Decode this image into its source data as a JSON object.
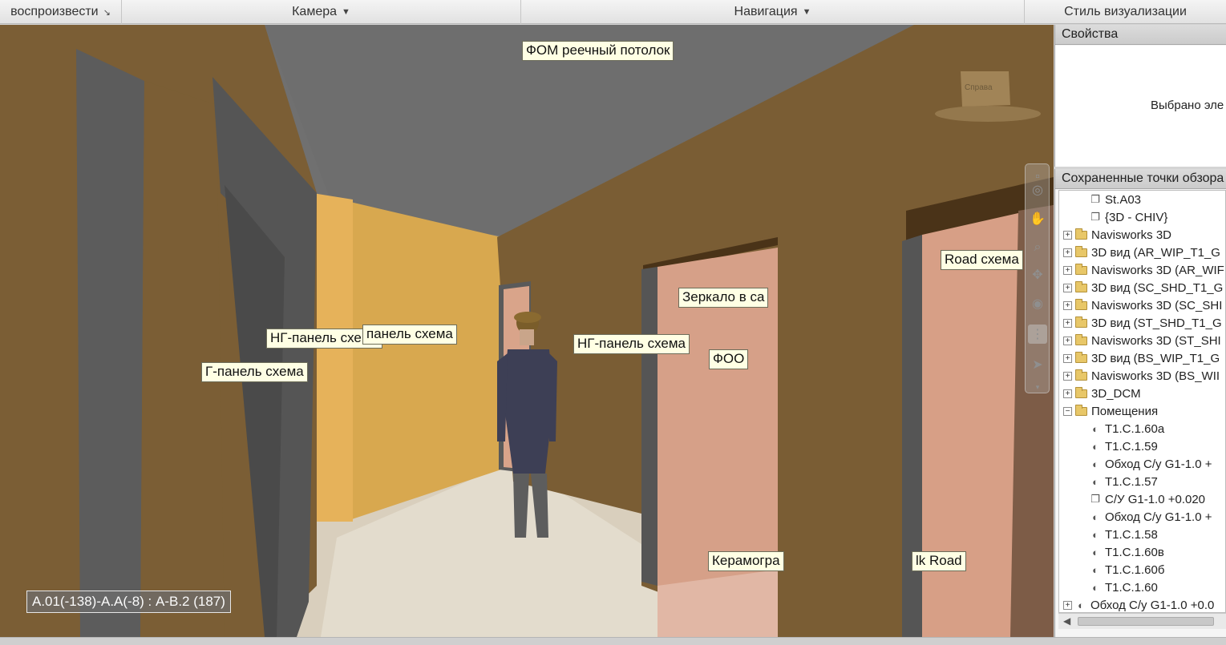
{
  "ribbon": {
    "groups": [
      {
        "label": "воспроизвести",
        "arrow": "↘"
      },
      {
        "label": "Камера",
        "arrow": "▼"
      },
      {
        "label": "Навигация",
        "arrow": "▼"
      },
      {
        "label": "Стиль визуализации",
        "arrow": ""
      }
    ]
  },
  "viewport": {
    "tags": [
      "ФОМ реечный потолок",
      "Road схема",
      "Зеркало в са",
      "НГ-панель схема",
      "ФОО",
      "НГ-панель схема",
      "панель схема",
      "Г-панель схема",
      "Керамогра",
      "lk Road"
    ],
    "coordinates": "А.01(-138)-А.А(-8) : А-В.2 (187)",
    "viewcube_label": "Справа",
    "colors": {
      "ceiling": "#707070",
      "wall_brown": "#7a5d35",
      "wall_yellow": "#d8a84e",
      "door_pink": "#d6a088",
      "floor": "#d7cdbb"
    }
  },
  "navbar": {
    "icons": [
      "wheel-icon",
      "pan-icon",
      "zoom-icon",
      "orbit-icon",
      "look-icon",
      "walk-icon",
      "select-icon"
    ]
  },
  "properties": {
    "title": "Свойства",
    "message": "Выбрано эле"
  },
  "viewpoints": {
    "title": "Сохраненные точки обзора",
    "items": [
      {
        "indent": 2,
        "kind": "view",
        "label": "St.A03"
      },
      {
        "indent": 2,
        "kind": "view",
        "label": "{3D - CHIV}"
      },
      {
        "indent": 0,
        "kind": "folder",
        "label": "Navisworks 3D"
      },
      {
        "indent": 0,
        "kind": "folder",
        "label": "3D вид (AR_WIP_T1_G"
      },
      {
        "indent": 0,
        "kind": "folder",
        "label": "Navisworks 3D (AR_WIF"
      },
      {
        "indent": 0,
        "kind": "folder",
        "label": "3D вид (SC_SHD_T1_G"
      },
      {
        "indent": 0,
        "kind": "folder",
        "label": "Navisworks 3D (SC_SHI"
      },
      {
        "indent": 0,
        "kind": "folder",
        "label": "3D вид (ST_SHD_T1_G"
      },
      {
        "indent": 0,
        "kind": "folder",
        "label": "Navisworks 3D (ST_SHI"
      },
      {
        "indent": 0,
        "kind": "folder",
        "label": "3D вид (BS_WIP_T1_G"
      },
      {
        "indent": 0,
        "kind": "folder",
        "label": "Navisworks 3D (BS_WII"
      },
      {
        "indent": 0,
        "kind": "folder",
        "label": "3D_DCM"
      },
      {
        "indent": 0,
        "kind": "folder-open",
        "label": "Помещения"
      },
      {
        "indent": 1,
        "kind": "anim",
        "label": "T1.C.1.60a"
      },
      {
        "indent": 1,
        "kind": "anim",
        "label": "T1.C.1.59"
      },
      {
        "indent": 1,
        "kind": "anim",
        "label": "Обход С/у G1-1.0 +"
      },
      {
        "indent": 1,
        "kind": "anim",
        "label": "T1.C.1.57"
      },
      {
        "indent": 1,
        "kind": "view",
        "label": "С/У G1-1.0 +0.020"
      },
      {
        "indent": 1,
        "kind": "anim",
        "label": "Обход С/у G1-1.0 +"
      },
      {
        "indent": 1,
        "kind": "anim",
        "label": "T1.C.1.58"
      },
      {
        "indent": 1,
        "kind": "anim",
        "label": "T1.C.1.60в"
      },
      {
        "indent": 1,
        "kind": "anim",
        "label": "T1.C.1.60б"
      },
      {
        "indent": 1,
        "kind": "anim",
        "label": "T1.C.1.60"
      },
      {
        "indent": 0,
        "kind": "anim-closed",
        "label": "Обход С/у G1-1.0 +0.0"
      }
    ]
  }
}
